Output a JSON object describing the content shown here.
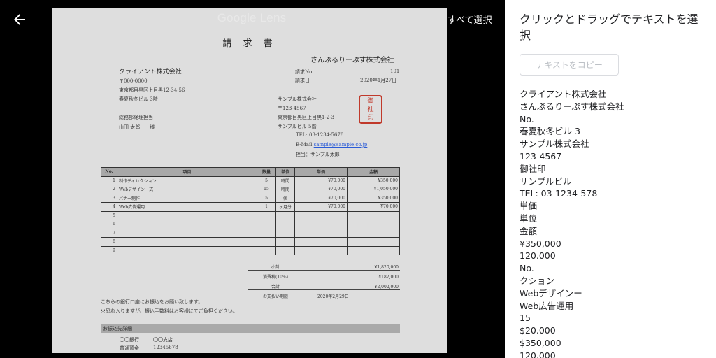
{
  "lens_title": "Google Lens",
  "select_all": "すべて選択",
  "document": {
    "title": "請 求 書",
    "issuer": "さんぷるりーぷす株式会社",
    "client": "クライアント株式会社",
    "client_postal": "〒000-0000",
    "client_address": "東京都目黒区上目黒12-34-56",
    "client_building": "春夏秋冬ビル 3階",
    "client_dept": "総務部経理担当",
    "client_person": "山田 太郎　　様",
    "invoice_no_label": "請求No.",
    "invoice_no": "101",
    "invoice_date_label": "請求日",
    "invoice_date": "2020年1月27日",
    "sender_company": "サンプル株式会社",
    "sender_postal": "〒123-4567",
    "sender_address": "東京都目黒区上目黒1-2-3",
    "sender_building": "サンプルビル 5階",
    "sender_tel": "TEL: 03-1234-5678",
    "sender_email_label": "E-Mail",
    "sender_email": "sample@sample.co.jp",
    "sender_contact": "担当：サンプル太郎",
    "stamp": "御社印",
    "table_headers": [
      "No.",
      "項目",
      "数量",
      "単位",
      "単価",
      "金額"
    ],
    "items": [
      {
        "no": "1",
        "name": "制作ディレクション",
        "qty": "5",
        "unit": "時間",
        "price": "¥70,000",
        "amount": "¥350,000"
      },
      {
        "no": "2",
        "name": "Webデザイン一式",
        "qty": "15",
        "unit": "時間",
        "price": "¥70,000",
        "amount": "¥1,050,000"
      },
      {
        "no": "3",
        "name": "バナー制作",
        "qty": "5",
        "unit": "個",
        "price": "¥70,000",
        "amount": "¥350,000"
      },
      {
        "no": "4",
        "name": "Web広告運用",
        "qty": "1",
        "unit": "ヶ月分",
        "price": "¥70,000",
        "amount": "¥70,000"
      },
      {
        "no": "5",
        "name": "",
        "qty": "",
        "unit": "",
        "price": "",
        "amount": ""
      },
      {
        "no": "6",
        "name": "",
        "qty": "",
        "unit": "",
        "price": "",
        "amount": ""
      },
      {
        "no": "7",
        "name": "",
        "qty": "",
        "unit": "",
        "price": "",
        "amount": ""
      },
      {
        "no": "8",
        "name": "",
        "qty": "",
        "unit": "",
        "price": "",
        "amount": ""
      },
      {
        "no": "9",
        "name": "",
        "qty": "",
        "unit": "",
        "price": "",
        "amount": ""
      }
    ],
    "subtotal_label": "小計",
    "subtotal": "¥1,820,000",
    "tax_label": "消費税(10%)",
    "tax": "¥182,000",
    "total_label": "合計",
    "total": "¥2,002,000",
    "due_label": "お支払い期限",
    "due": "2020年2月29日",
    "note1": "こちらの銀行口座にお振込をお願い致します。",
    "note2": "※恐れ入りますが、振込手数料はお客様にてご負担ください。",
    "bank_header": "お振込先詳細",
    "bank_name": "〇〇銀行",
    "bank_branch": "〇〇支店",
    "bank_type": "普通預金",
    "bank_account": "12345678"
  },
  "panel": {
    "heading": "クリックとドラッグでテキストを選択",
    "copy_button": "テキストをコピー",
    "lines": [
      "クライアント株式会社",
      "さんぷるりーぷす株式会社",
      "No.",
      "春夏秋冬ビル 3",
      "サンプル株式会社",
      "123-4567",
      "御社印",
      "サンプルビル",
      "TEL: 03-1234-578",
      "単価",
      "単位",
      "金額",
      "¥350,000",
      "120.000",
      "No.",
      "クション",
      "Webデザインー",
      "Web広告運用",
      "15",
      "$20.000",
      "$350,000",
      "120.000"
    ]
  }
}
